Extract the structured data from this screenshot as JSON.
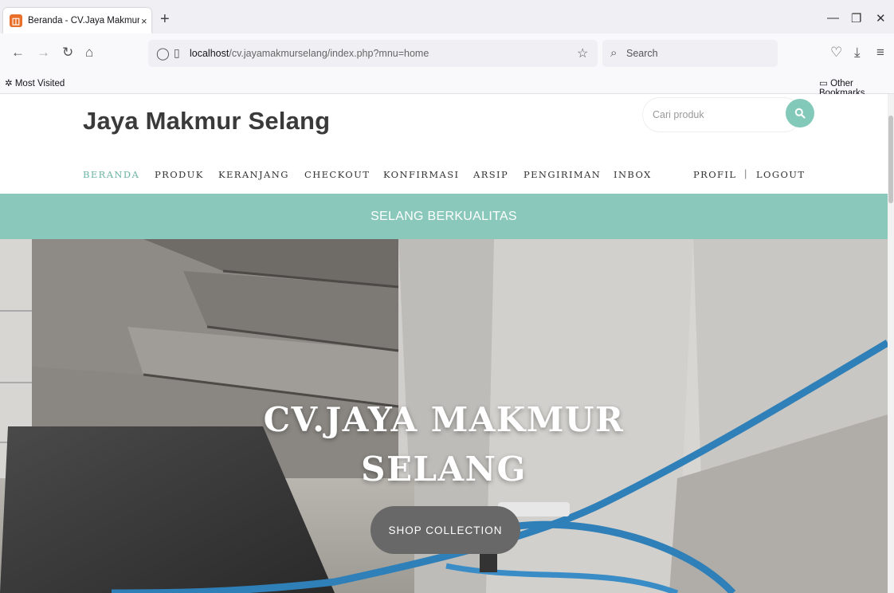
{
  "browser": {
    "tab_title": "Beranda - CV.Jaya Makmur Selang",
    "tab_close": "×",
    "new_tab": "+",
    "url_host": "localhost",
    "url_path": "/cv.jayamakmurselang/index.php?mnu=home",
    "search_label": "Search",
    "bookmarks": {
      "most_visited": "Most Visited",
      "other": "Other Bookmarks"
    }
  },
  "site": {
    "brand": "Jaya Makmur Selang",
    "search_placeholder": "Cari produk",
    "menu": [
      "BERANDA",
      "PRODUK",
      "KERANJANG",
      "CHECKOUT",
      "KONFIRMASI",
      "ARSIP",
      "PENGIRIMAN",
      "INBOX"
    ],
    "active_menu": "BERANDA",
    "profile": "PROFIL",
    "separator": "|",
    "logout": "LOGOUT",
    "tagline": "SELANG BERKUALITAS",
    "hero_title_line1": "CV.JAYA MAKMUR",
    "hero_title_line2": "SELANG",
    "hero_button": "SHOP COLLECTION"
  },
  "colors": {
    "accent": "#89c8ba",
    "active_menu": "#6bb5a4",
    "hero_button": "#686868"
  }
}
